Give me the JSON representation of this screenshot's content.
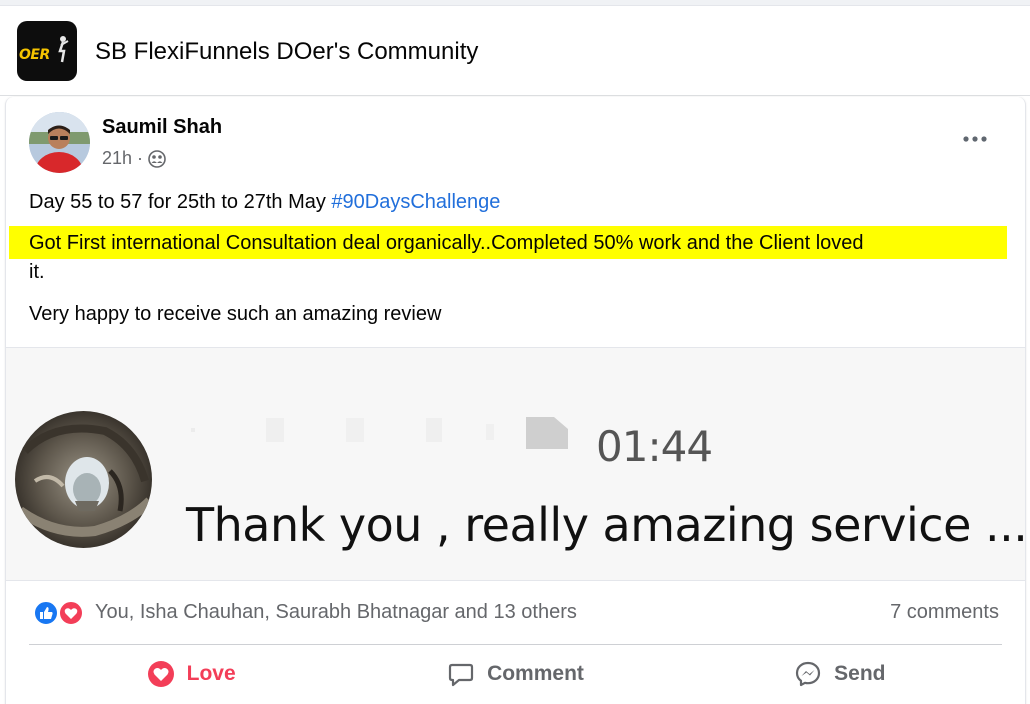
{
  "group": {
    "title": "SB FlexiFunnels DOer's Community",
    "logo_text": "OER",
    "logo_icon": "doer-logo-icon"
  },
  "post": {
    "author": "Saumil Shah",
    "time": "21h",
    "meta_separator": "·",
    "audience_icon": "group-audience-icon",
    "more_icon": "more-horizontal-icon",
    "line1_text": "Day 55 to 57 for 25th to 27th May ",
    "hashtag": "#90DaysChallenge",
    "line2_text": "Got First international Consultation deal organically..Completed 50% work and the Client loved",
    "line2_wrap": "it.",
    "line3_text": "Very happy to receive such an amazing review",
    "image": {
      "time": "01:44",
      "caption": "Thank you , really amazing service ..."
    }
  },
  "reactions": {
    "icons": [
      "like-icon",
      "love-icon"
    ],
    "summary": "You, Isha Chauhan, Saurabh Bhatnagar and 13 others",
    "comments": "7 comments"
  },
  "actions": [
    {
      "label": "Love",
      "icon": "love-heart-icon"
    },
    {
      "label": "Comment",
      "icon": "comment-icon"
    },
    {
      "label": "Send",
      "icon": "messenger-icon"
    }
  ],
  "colors": {
    "highlight": "#ffff00",
    "hashtag": "#216fdb",
    "love": "#f33e58",
    "meta_gray": "#65676b",
    "like_blue": "#1877f2"
  }
}
